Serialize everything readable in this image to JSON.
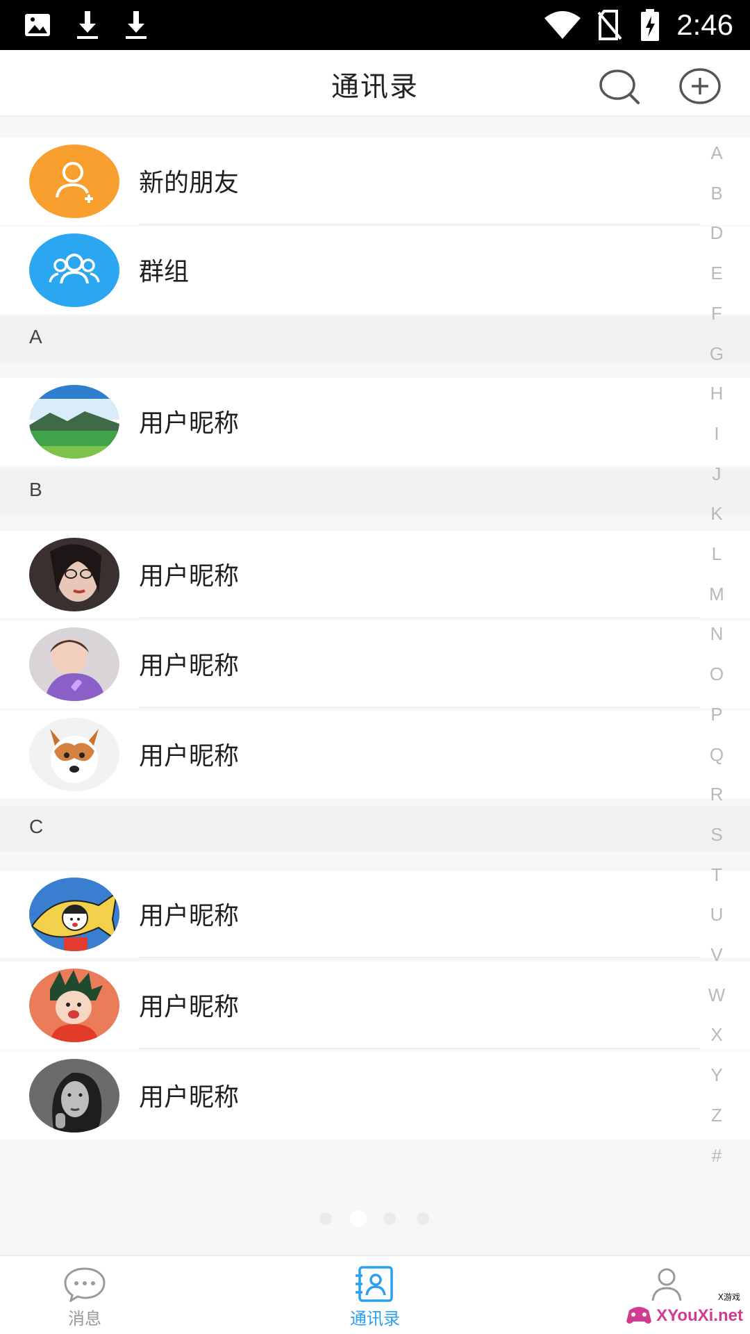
{
  "status_bar": {
    "time": "2:46",
    "left_icons": [
      "image-icon",
      "download-icon",
      "download-icon"
    ],
    "right_icons": [
      "wifi-icon",
      "no-sim-icon",
      "battery-charging-icon"
    ]
  },
  "header": {
    "title": "通讯录",
    "search_icon": "search-icon",
    "add_icon": "add-circle-icon"
  },
  "top_items": [
    {
      "label": "新的朋友",
      "icon": "add-friend-icon",
      "color": "#f7a030"
    },
    {
      "label": "群组",
      "icon": "group-icon",
      "color": "#2ba6f0"
    }
  ],
  "sections": [
    {
      "letter": "A",
      "contacts": [
        {
          "name": "用户昵称"
        }
      ]
    },
    {
      "letter": "B",
      "contacts": [
        {
          "name": "用户昵称"
        },
        {
          "name": "用户昵称"
        },
        {
          "name": "用户昵称"
        }
      ]
    },
    {
      "letter": "C",
      "contacts": [
        {
          "name": "用户昵称"
        },
        {
          "name": "用户昵称"
        },
        {
          "name": "用户昵称"
        }
      ]
    }
  ],
  "index_letters": [
    "A",
    "B",
    "D",
    "E",
    "F",
    "G",
    "H",
    "I",
    "J",
    "K",
    "L",
    "M",
    "N",
    "O",
    "P",
    "Q",
    "R",
    "S",
    "T",
    "U",
    "V",
    "W",
    "X",
    "Y",
    "Z",
    "#"
  ],
  "pager": {
    "count": 4,
    "active": 2
  },
  "tab_bar": {
    "tabs": [
      {
        "label": "消息",
        "icon": "chat-bubble-icon",
        "active": false
      },
      {
        "label": "通讯录",
        "icon": "contacts-book-icon",
        "active": true
      },
      {
        "label": "",
        "icon": "profile-icon",
        "active": false
      }
    ],
    "active_color": "#2b9ff0"
  },
  "watermark": {
    "text": "XYouXi.net",
    "small": "X游戏"
  }
}
